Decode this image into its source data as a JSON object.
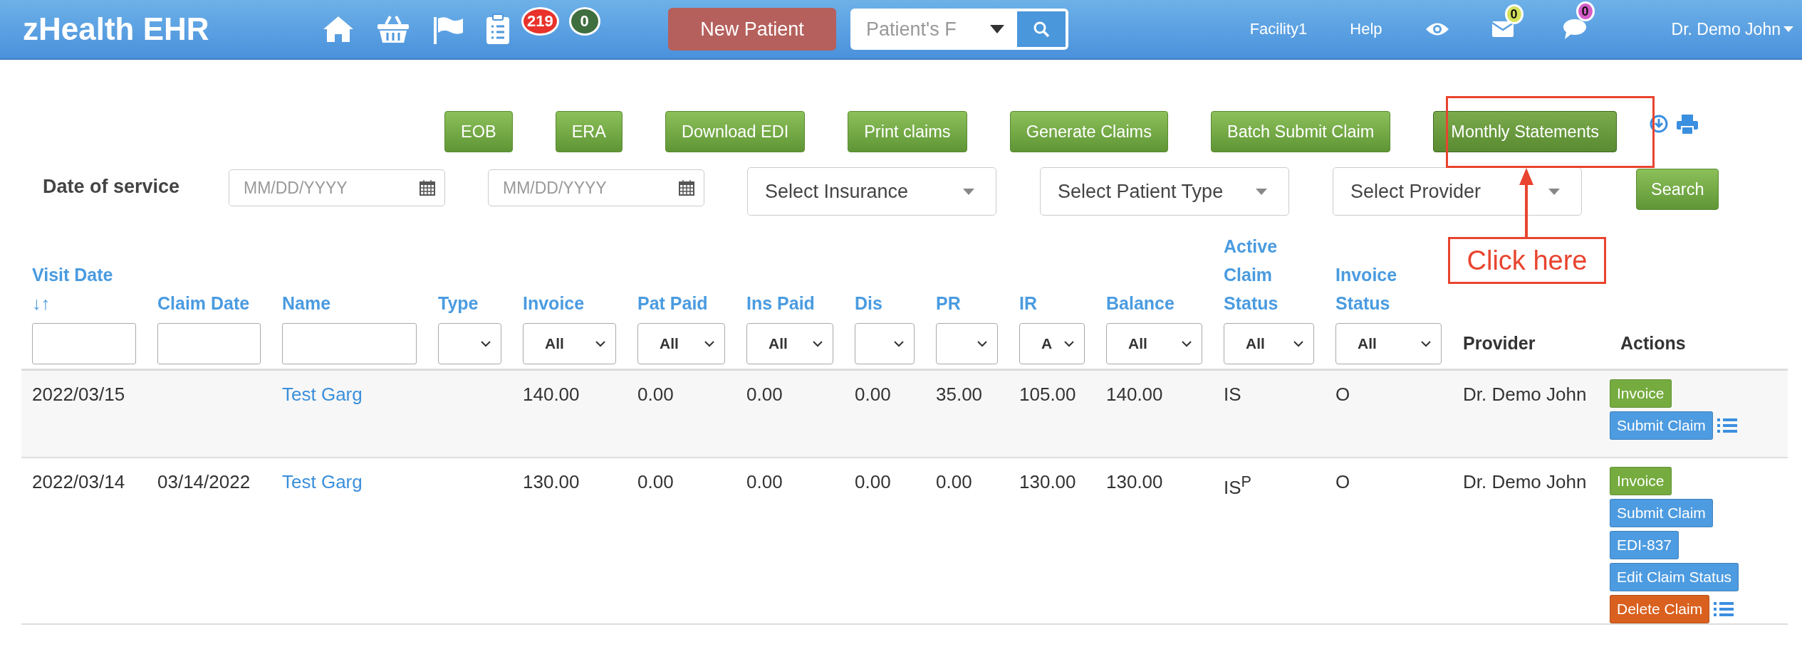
{
  "header": {
    "brand": "zHealth EHR",
    "nav_icons": [
      {
        "kind": "home"
      },
      {
        "kind": "basket"
      },
      {
        "kind": "flag"
      },
      {
        "kind": "clipboard"
      }
    ],
    "badges": [
      {
        "count": "219",
        "color": "#e8322b"
      },
      {
        "count": "0",
        "color": "#3f6e3f"
      }
    ],
    "new_patient_button": "New Patient",
    "search": {
      "placeholder": "Patient's F"
    },
    "facility": "Facility1",
    "help": "Help",
    "notifications": [
      {
        "kind": "mail",
        "count": "0",
        "color": "#d4e25a"
      },
      {
        "kind": "chat",
        "count": "0",
        "color": "#d45cc8"
      }
    ],
    "user": "Dr. Demo John"
  },
  "toolbar": [
    {
      "label": "EOB",
      "selected": false
    },
    {
      "label": "ERA",
      "selected": false
    },
    {
      "label": "Download EDI",
      "selected": false
    },
    {
      "label": "Print claims",
      "selected": false
    },
    {
      "label": "Generate Claims",
      "selected": false
    },
    {
      "label": "Batch Submit Claim",
      "selected": false
    },
    {
      "label": "Monthly Statements",
      "selected": true
    }
  ],
  "filters": {
    "label": "Date of service",
    "date_fields": [
      {
        "placeholder": "MM/DD/YYYY"
      },
      {
        "placeholder": "MM/DD/YYYY"
      }
    ],
    "selects": [
      {
        "value": "Select Insurance"
      },
      {
        "value": "Select Patient Type"
      },
      {
        "value": "Select Provider"
      }
    ],
    "search_button": "Search"
  },
  "annotation": {
    "label": "Click here"
  },
  "table": {
    "columns": [
      {
        "label": "Visit Date",
        "sort": "↓↑",
        "kind": "text"
      },
      {
        "label": "Claim Date",
        "kind": "text"
      },
      {
        "label": "Name",
        "kind": "text"
      },
      {
        "label": "Type",
        "kind": "select"
      },
      {
        "label": "Invoice",
        "kind": "select",
        "value": "All"
      },
      {
        "label": "Pat Paid",
        "kind": "select",
        "value": "All"
      },
      {
        "label": "Ins Paid",
        "kind": "select",
        "value": "All"
      },
      {
        "label": "Dis",
        "kind": "select"
      },
      {
        "label": "PR",
        "kind": "select"
      },
      {
        "label": "IR",
        "kind": "select",
        "value": "A"
      },
      {
        "label": "Balance",
        "kind": "select",
        "value": "All"
      },
      {
        "label": "Active Claim Status",
        "kind": "select",
        "value": "All"
      },
      {
        "label": "Invoice Status",
        "kind": "select",
        "value": "All"
      },
      {
        "label": "Provider",
        "kind": "plain"
      },
      {
        "label": "Actions",
        "kind": "plain"
      }
    ],
    "rows": [
      {
        "cells": [
          "2022/03/15",
          "",
          "Test Garg",
          "",
          "140.00",
          "0.00",
          "0.00",
          "0.00",
          "35.00",
          "105.00",
          "140.00",
          "IS",
          "O",
          "Dr. Demo John"
        ],
        "actions": [
          {
            "label": "Invoice",
            "kind": "invoice"
          },
          {
            "label": "Submit Claim",
            "kind": "primary"
          }
        ]
      },
      {
        "cells": [
          "2022/03/14",
          "03/14/2022",
          "Test Garg",
          "",
          "130.00",
          "0.00",
          "0.00",
          "0.00",
          "0.00",
          "130.00",
          "130.00",
          "IS$^{P}$",
          "O",
          "Dr. Demo John"
        ],
        "actions": [
          {
            "label": "Invoice",
            "kind": "invoice"
          },
          {
            "label": "Submit Claim",
            "kind": "primary"
          },
          {
            "label": "EDI-837",
            "kind": "primary"
          },
          {
            "label": "Edit Claim Status",
            "kind": "primary"
          },
          {
            "label": "Delete Claim",
            "kind": "danger"
          }
        ]
      }
    ]
  }
}
